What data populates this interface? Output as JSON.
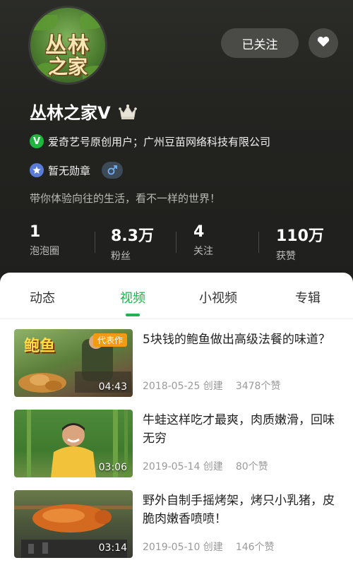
{
  "profile": {
    "name": "丛林之家V",
    "avatar_text_top": "丛林",
    "avatar_text_bottom": "之家",
    "follow_label": "已关注",
    "verify_text": "爱奇艺号原创用户；广州豆苗网络科技有限公司",
    "verify_badge": "V",
    "medal_text": "暂无勋章",
    "bio": "带你体验向往的生活，看不一样的世界！",
    "gender_icon": "male-icon",
    "accent_color": "#23b14d"
  },
  "stats": [
    {
      "value": "1",
      "label": "泡泡圈"
    },
    {
      "value": "8.3万",
      "label": "粉丝"
    },
    {
      "value": "4",
      "label": "关注"
    },
    {
      "value": "110万",
      "label": "获赞"
    }
  ],
  "tabs": [
    {
      "label": "动态"
    },
    {
      "label": "视频",
      "active": true
    },
    {
      "label": "小视频"
    },
    {
      "label": "专辑"
    }
  ],
  "videos": [
    {
      "title": "5块钱的鲍鱼做出高级法餐的味道？",
      "date": "2018-05-25 创建",
      "likes": "3478个赞",
      "duration": "04:43",
      "thumb_badge": "代表作",
      "thumb_title": "鲍鱼"
    },
    {
      "title": "牛蛙这样吃才最爽，肉质嫩滑，回味无穷",
      "date": "2019-05-14 创建",
      "likes": "80个赞",
      "duration": "03:06"
    },
    {
      "title": "野外自制手摇烤架，烤只小乳猪，皮脆肉嫩香喷喷！",
      "date": "2019-05-10 创建",
      "likes": "146个赞",
      "duration": "03:14"
    }
  ]
}
